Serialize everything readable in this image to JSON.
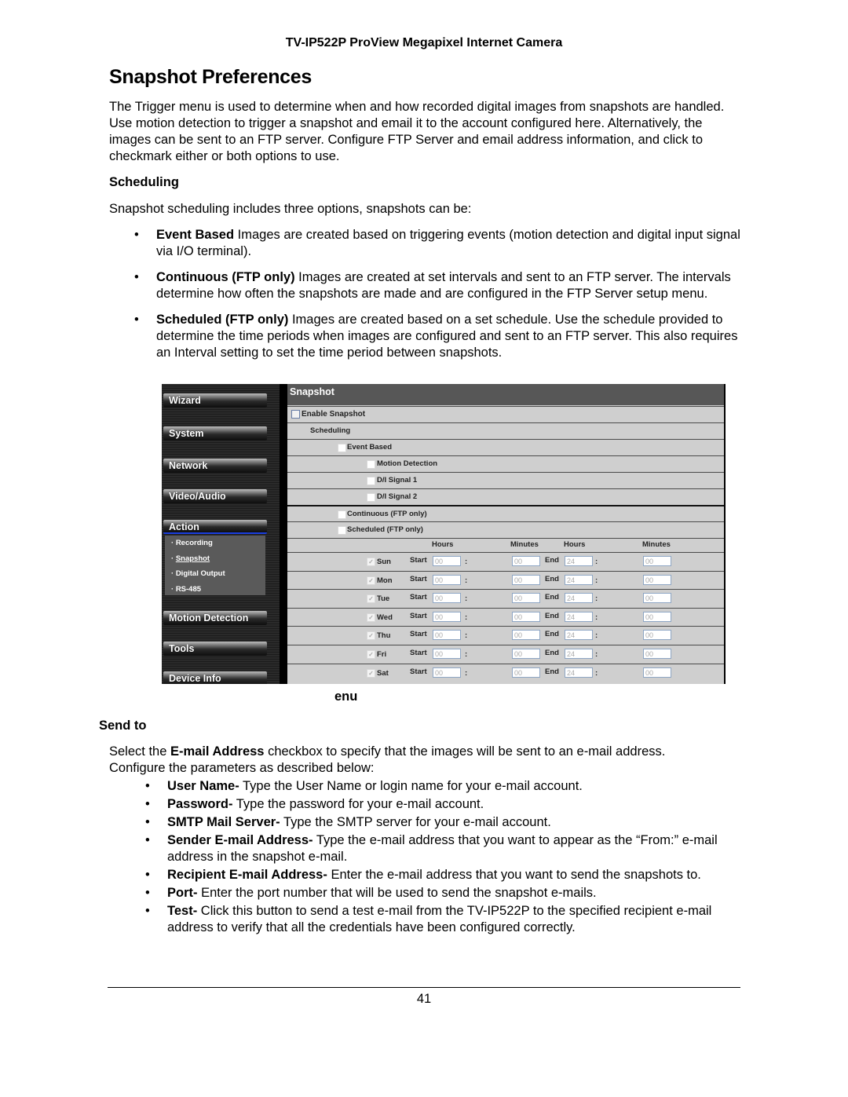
{
  "header": {
    "title": "TV-IP522P ProView Megapixel Internet Camera"
  },
  "page_title": "Snapshot Preferences",
  "intro": "The Trigger menu is used to determine when and how recorded digital images from snapshots are handled. Use motion detection to trigger a snapshot and email it to the account configured here. Alternatively, the images can be sent to an FTP server. Configure FTP Server and email address information, and click to checkmark either or both options to use.",
  "scheduling": {
    "heading": "Scheduling",
    "lead": "Snapshot scheduling includes three options, snapshots can be:",
    "items": [
      {
        "term": "Event Based",
        "text": " Images are created based on triggering events (motion detection and digital input signal via I/O terminal)."
      },
      {
        "term": "Continuous (FTP only)",
        "text": " Images are created at set intervals and sent to an FTP server. The intervals determine how often the snapshots are made and are configured in the FTP Server setup menu."
      },
      {
        "term": "Scheduled (FTP only)",
        "text": " Images are created based on a set schedule. Use the schedule provided to determine the time periods when images are configured and sent to an FTP server. This also requires an Interval setting to set the time period between snapshots."
      }
    ]
  },
  "screenshot": {
    "nav": [
      "Wizard",
      "System",
      "Network",
      "Video/Audio",
      "Action",
      "Motion Detection",
      "Tools",
      "Device Info"
    ],
    "action_sub": [
      "Recording",
      "Snapshot",
      "Digital Output",
      "RS-485"
    ],
    "panel_title": "Snapshot",
    "enable": "Enable Snapshot",
    "scheduling": "Scheduling",
    "event_based": "Event Based",
    "motion_detection": "Motion Detection",
    "di1": "D/I Signal 1",
    "di2": "D/I Signal 2",
    "continuous": "Continuous (FTP only)",
    "scheduled": "Scheduled (FTP only)",
    "col_hours": "Hours",
    "col_minutes": "Minutes",
    "start_label": "Start",
    "end_label": "End",
    "colon": ":",
    "days": [
      {
        "day": "Sun",
        "sh": "00",
        "sm": "00",
        "eh": "24",
        "em": "00"
      },
      {
        "day": "Mon",
        "sh": "00",
        "sm": "00",
        "eh": "24",
        "em": "00"
      },
      {
        "day": "Tue",
        "sh": "00",
        "sm": "00",
        "eh": "24",
        "em": "00"
      },
      {
        "day": "Wed",
        "sh": "00",
        "sm": "00",
        "eh": "24",
        "em": "00"
      },
      {
        "day": "Thu",
        "sh": "00",
        "sm": "00",
        "eh": "24",
        "em": "00"
      },
      {
        "day": "Fri",
        "sh": "00",
        "sm": "00",
        "eh": "24",
        "em": "00"
      },
      {
        "day": "Sat",
        "sh": "00",
        "sm": "00",
        "eh": "24",
        "em": "00"
      }
    ]
  },
  "caption": "enu",
  "send_to": {
    "heading": "Send to",
    "lead_pre": "Select the ",
    "lead_term": "E-mail Address",
    "lead_post": " checkbox to specify that the images will be sent to an e-mail address. Configure the parameters as described below:",
    "items": [
      {
        "term": "User Name-",
        "text": " Type the User Name or login name for your e-mail account."
      },
      {
        "term": "Password-",
        "text": " Type the password for your e-mail account."
      },
      {
        "term": "SMTP Mail Server-",
        "text": " Type the SMTP server for your e-mail account."
      },
      {
        "term": "Sender E-mail Address-",
        "text": " Type the e-mail address that you want to appear as the “From:” e-mail address in the snapshot e-mail."
      },
      {
        "term": "Recipient E-mail Address-",
        "text": " Enter the e-mail address that you want to send the snapshots to."
      },
      {
        "term": "Port-",
        "text": " Enter the port number that will be used to send the snapshot e-mails."
      },
      {
        "term": "Test-",
        "text": " Click this button to send a test e-mail from the TV-IP522P to the specified recipient e-mail address to verify that all the credentials have been configured correctly."
      }
    ]
  },
  "bullet": "•",
  "page_number": "41"
}
